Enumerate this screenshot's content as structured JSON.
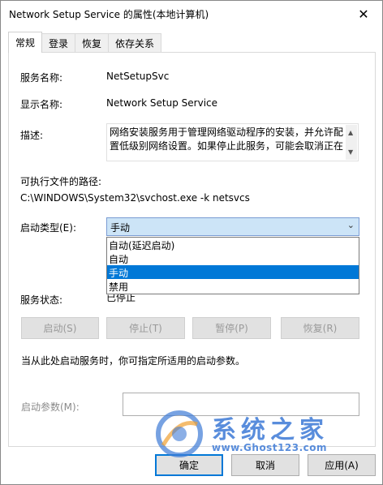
{
  "window": {
    "title": "Network Setup Service 的属性(本地计算机)",
    "close_glyph": "✕"
  },
  "tabs": [
    {
      "label": "常规"
    },
    {
      "label": "登录"
    },
    {
      "label": "恢复"
    },
    {
      "label": "依存关系"
    }
  ],
  "general": {
    "service_name_label": "服务名称:",
    "service_name": "NetSetupSvc",
    "display_name_label": "显示名称:",
    "display_name": "Network Setup Service",
    "description_label": "描述:",
    "description": "网络安装服务用于管理网络驱动程序的安装，并允许配置低级别网络设置。如果停止此服务，可能会取消正在",
    "path_label": "可执行文件的路径:",
    "path": "C:\\WINDOWS\\System32\\svchost.exe -k netsvcs",
    "startup_type_label": "启动类型(E):",
    "startup_type_value": "手动",
    "startup_options": [
      "自动(延迟启动)",
      "自动",
      "手动",
      "禁用"
    ],
    "startup_selected_index": 2,
    "status_label": "服务状态:",
    "status_value": "已停止",
    "start_button": "启动(S)",
    "stop_button": "停止(T)",
    "pause_button": "暂停(P)",
    "resume_button": "恢复(R)",
    "note": "当从此处启动服务时，你可指定所适用的启动参数。",
    "params_label": "启动参数(M):",
    "params_value": ""
  },
  "footer": {
    "ok_button": "确定",
    "cancel_button": "取消",
    "apply_button": "应用(A)"
  },
  "watermark": {
    "text": "系统之家",
    "url": "www.Ghost123.com"
  },
  "colors": {
    "accent": "#0078d7",
    "select_bg": "#cce4f7",
    "watermark": "#3d7ad6"
  }
}
